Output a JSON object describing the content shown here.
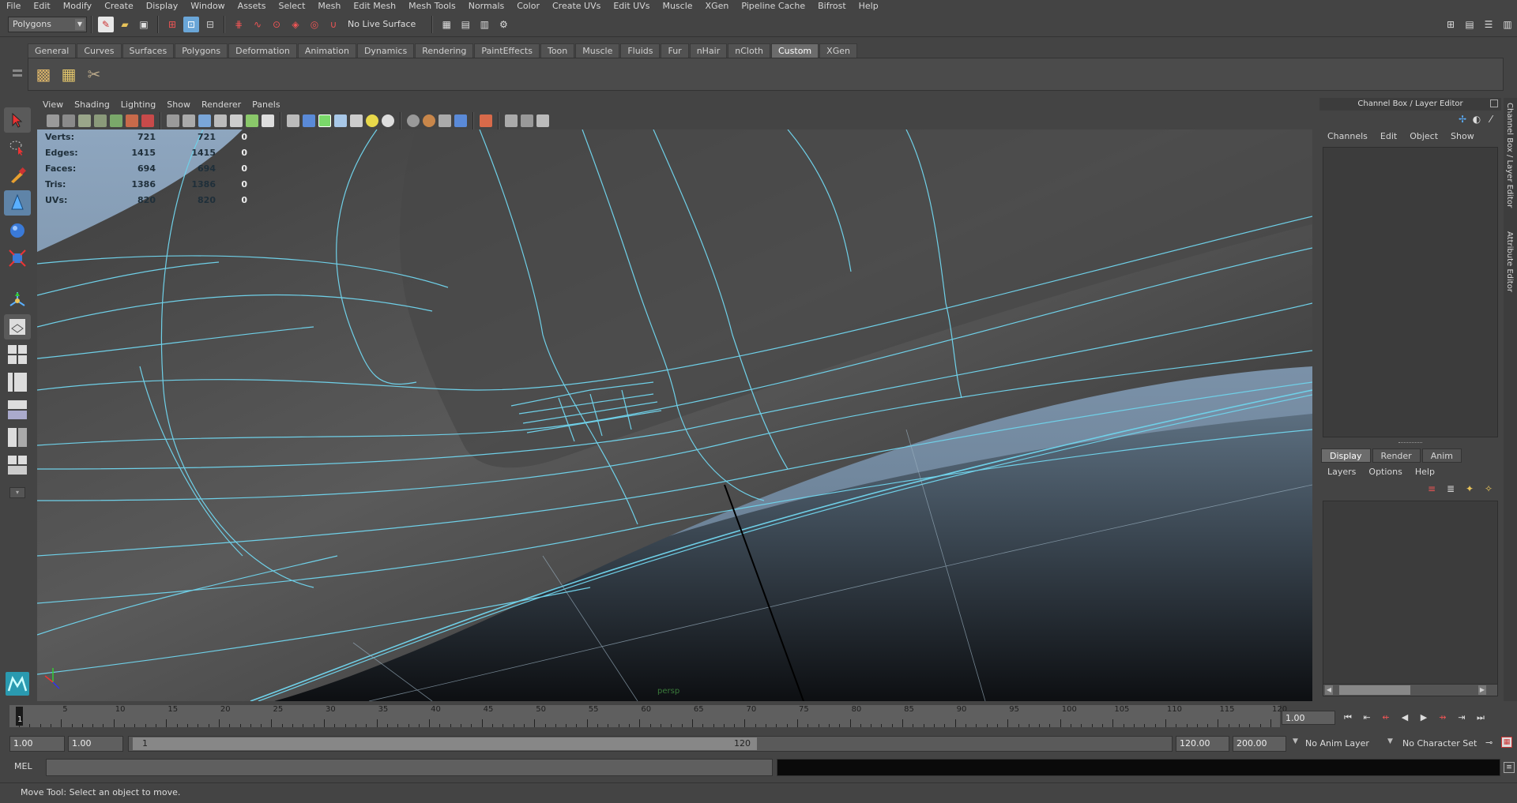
{
  "menubar": {
    "items": [
      "File",
      "Edit",
      "Modify",
      "Create",
      "Display",
      "Window",
      "Assets",
      "Select",
      "Mesh",
      "Edit Mesh",
      "Mesh Tools",
      "Normals",
      "Color",
      "Create UVs",
      "Edit UVs",
      "Muscle",
      "XGen",
      "Pipeline Cache",
      "Bifrost",
      "Help"
    ]
  },
  "statusline": {
    "mode": "Polygons",
    "live_surface": "No Live Surface"
  },
  "shelf": {
    "tabs": [
      "General",
      "Curves",
      "Surfaces",
      "Polygons",
      "Deformation",
      "Animation",
      "Dynamics",
      "Rendering",
      "PaintEffects",
      "Toon",
      "Muscle",
      "Fluids",
      "Fur",
      "nHair",
      "nCloth",
      "Custom",
      "XGen"
    ],
    "active_tab": "Custom",
    "icons": [
      "cube-stack-icon",
      "uv-grid-icon",
      "tools-icon"
    ]
  },
  "viewport": {
    "menu": [
      "View",
      "Shading",
      "Lighting",
      "Show",
      "Renderer",
      "Panels"
    ],
    "hud": [
      {
        "label": "Verts:",
        "v1": "721",
        "v2": "721",
        "v3": "0"
      },
      {
        "label": "Edges:",
        "v1": "1415",
        "v2": "1415",
        "v3": "0"
      },
      {
        "label": "Faces:",
        "v1": "694",
        "v2": "694",
        "v3": "0"
      },
      {
        "label": "Tris:",
        "v1": "1386",
        "v2": "1386",
        "v3": "0"
      },
      {
        "label": "UVs:",
        "v1": "820",
        "v2": "820",
        "v3": "0"
      }
    ],
    "camera": "persp",
    "wire_color": "#6fd0e8"
  },
  "channel_box": {
    "title": "Channel Box / Layer Editor",
    "menu": [
      "Channels",
      "Edit",
      "Object",
      "Show"
    ]
  },
  "layer_editor": {
    "tabs": [
      "Display",
      "Render",
      "Anim"
    ],
    "active_tab": "Display",
    "menu": [
      "Layers",
      "Options",
      "Help"
    ]
  },
  "side_tabs": [
    "Channel Box / Layer Editor",
    "Attribute Editor"
  ],
  "time_slider": {
    "ticks": [
      "5",
      "10",
      "15",
      "20",
      "25",
      "30",
      "35",
      "40",
      "45",
      "50",
      "55",
      "60",
      "65",
      "70",
      "75",
      "80",
      "85",
      "90",
      "95",
      "100",
      "105",
      "110",
      "115",
      "120"
    ],
    "current": "1",
    "current_field": "1.00"
  },
  "range": {
    "start": "1.00",
    "min": "1.00",
    "handle_start": "1",
    "handle_end": "120",
    "end": "120.00",
    "max": "200.00",
    "anim_layer": "No Anim Layer",
    "char_set": "No Character Set"
  },
  "command": {
    "label": "MEL"
  },
  "help": {
    "text": "Move Tool: Select an object to move."
  }
}
